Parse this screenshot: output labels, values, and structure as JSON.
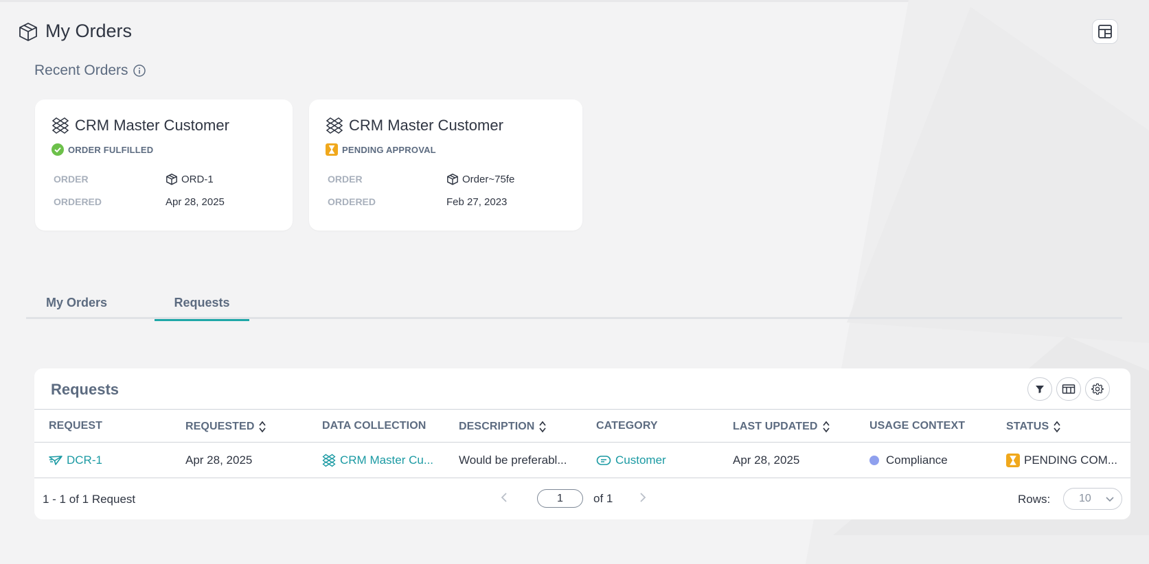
{
  "header": {
    "title": "My Orders"
  },
  "recent": {
    "title": "Recent Orders",
    "cards": [
      {
        "title": "CRM Master Customer",
        "status": "ORDER FULFILLED",
        "order_label": "ORDER",
        "order_value": "ORD-1",
        "ordered_label": "ORDERED",
        "ordered_value": "Apr 28, 2025"
      },
      {
        "title": "CRM Master Customer",
        "status": "PENDING APPROVAL",
        "order_label": "ORDER",
        "order_value": "Order~75fe",
        "ordered_label": "ORDERED",
        "ordered_value": "Feb 27, 2023"
      }
    ]
  },
  "tabs": [
    {
      "label": "My Orders"
    },
    {
      "label": "Requests"
    }
  ],
  "requests": {
    "title": "Requests",
    "columns": [
      "REQUEST",
      "REQUESTED",
      "DATA COLLECTION",
      "DESCRIPTION",
      "CATEGORY",
      "LAST UPDATED",
      "USAGE CONTEXT",
      "STATUS"
    ],
    "rows": [
      {
        "request": "DCR-1",
        "requested": "Apr 28, 2025",
        "data_collection": "CRM Master Cu...",
        "description": "Would be preferabl...",
        "category": "Customer",
        "last_updated": "Apr 28, 2025",
        "usage_context": "Compliance",
        "status": "PENDING COM..."
      }
    ],
    "footer": {
      "count": "1 - 1 of 1 Request",
      "page": "1",
      "of": "of 1",
      "rows_label": "Rows:",
      "rows_value": "10"
    }
  },
  "colors": {
    "accent": "#1ea7a7",
    "link": "#1b9aa3",
    "fulfilled": "#6cc04a",
    "pending": "#f0a81c",
    "usage_dot": "#8fa0ee"
  }
}
